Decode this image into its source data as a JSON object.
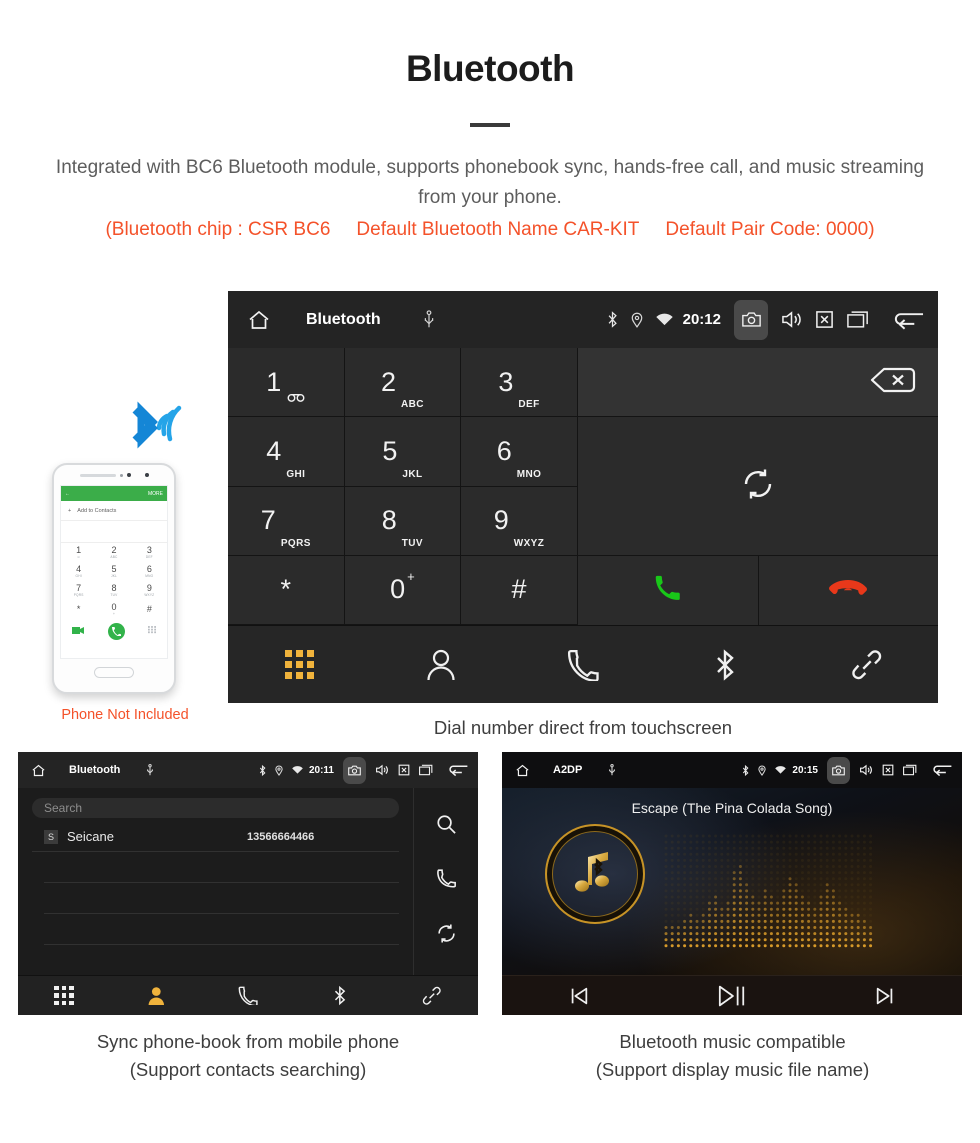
{
  "header": {
    "title": "Bluetooth",
    "description": "Integrated with BC6 Bluetooth module, supports phonebook sync, hands-free call, and music streaming from your phone.",
    "spec_chip": "(Bluetooth chip : CSR BC6",
    "spec_name": "Default Bluetooth Name CAR-KIT",
    "spec_pair": "Default Pair Code: 0000)",
    "accent_color": "#f4522a",
    "text_color": "#5d5d5d"
  },
  "dialer_unit": {
    "statusbar": {
      "home_icon": "home-icon",
      "title": "Bluetooth",
      "usb_icon": "usb-icon",
      "bluetooth_icon": "bluetooth-icon",
      "location_icon": "location-icon",
      "wifi_icon": "wifi-icon",
      "time": "20:12",
      "camera_icon": "camera-icon",
      "volume_icon": "volume-icon",
      "close_icon": "close-box-icon",
      "recents_icon": "recent-apps-icon",
      "back_icon": "back-arrow-icon"
    },
    "keys": [
      {
        "num": "1",
        "sub": "",
        "voicemail": true
      },
      {
        "num": "2",
        "sub": "ABC",
        "voicemail": false
      },
      {
        "num": "3",
        "sub": "DEF",
        "voicemail": false
      },
      {
        "num": "4",
        "sub": "GHI",
        "voicemail": false
      },
      {
        "num": "5",
        "sub": "JKL",
        "voicemail": false
      },
      {
        "num": "6",
        "sub": "MNO",
        "voicemail": false
      },
      {
        "num": "7",
        "sub": "PQRS",
        "voicemail": false
      },
      {
        "num": "8",
        "sub": "TUV",
        "voicemail": false
      },
      {
        "num": "9",
        "sub": "WXYZ",
        "voicemail": false
      },
      {
        "num": "*",
        "sub": "",
        "voicemail": false
      },
      {
        "num": "0",
        "sub": "",
        "plus": "+",
        "voicemail": false
      },
      {
        "num": "#",
        "sub": "",
        "voicemail": false
      }
    ],
    "number_input_value": "",
    "backspace_icon": "backspace-icon",
    "sync_icon": "sync-icon",
    "call_icon": "call-icon",
    "hangup_icon": "hangup-icon",
    "call_color": "#19c719",
    "hangup_color": "#e8381a",
    "navbar": [
      {
        "icon": "dialpad-icon",
        "active": true
      },
      {
        "icon": "contacts-icon",
        "active": false
      },
      {
        "icon": "call-log-icon",
        "active": false
      },
      {
        "icon": "bluetooth-icon",
        "active": false
      },
      {
        "icon": "pair-link-icon",
        "active": false
      }
    ],
    "active_color": "#f0b33c"
  },
  "phone_illustration": {
    "bluetooth_icon": "bluetooth-wireless-icon",
    "bluetooth_color": "#1b9ee0",
    "screen_header_more": "MORE",
    "screen_back_icon": "back-arrow-icon",
    "add_to_contacts": "Add to Contacts",
    "keys": [
      {
        "num": "1",
        "sub": "∞"
      },
      {
        "num": "2",
        "sub": "ABC"
      },
      {
        "num": "3",
        "sub": "DEF"
      },
      {
        "num": "4",
        "sub": "GHI"
      },
      {
        "num": "5",
        "sub": "JKL"
      },
      {
        "num": "6",
        "sub": "MNO"
      },
      {
        "num": "7",
        "sub": "PQRS"
      },
      {
        "num": "8",
        "sub": "TUV"
      },
      {
        "num": "9",
        "sub": "WXYZ"
      },
      {
        "num": "*",
        "sub": ""
      },
      {
        "num": "0",
        "sub": "+"
      },
      {
        "num": "#",
        "sub": ""
      }
    ],
    "caption": "Phone Not Included",
    "caption_color": "#f4522a"
  },
  "captions": {
    "dialer": "Dial number direct from touchscreen",
    "phonebook_line1": "Sync phone-book from mobile phone",
    "phonebook_line2": "(Support contacts searching)",
    "music_line1": "Bluetooth music compatible",
    "music_line2": "(Support display music file name)"
  },
  "phonebook_unit": {
    "statusbar": {
      "title": "Bluetooth",
      "time": "20:11"
    },
    "search_placeholder": "Search",
    "search_value": "",
    "contacts": [
      {
        "initial": "S",
        "name": "Seicane",
        "number": "13566664466"
      }
    ],
    "empty_row_count": 3,
    "side_icons": [
      {
        "icon": "search-icon"
      },
      {
        "icon": "call-icon"
      },
      {
        "icon": "sync-icon"
      }
    ],
    "navbar": [
      {
        "icon": "dialpad-icon",
        "active": false
      },
      {
        "icon": "contacts-icon",
        "active": true
      },
      {
        "icon": "call-log-icon",
        "active": false
      },
      {
        "icon": "bluetooth-icon",
        "active": false
      },
      {
        "icon": "pair-link-icon",
        "active": false
      }
    ]
  },
  "music_unit": {
    "statusbar": {
      "title": "A2DP",
      "time": "20:15"
    },
    "track_title": "Escape (The Pina Colada Song)",
    "album_icon": "music-note-bluetooth-icon",
    "visualizer": "dot-matrix-equalizer",
    "accent_color": "#c79326",
    "controls": [
      {
        "icon": "previous-track-icon"
      },
      {
        "icon": "play-pause-icon"
      },
      {
        "icon": "next-track-icon"
      }
    ]
  }
}
